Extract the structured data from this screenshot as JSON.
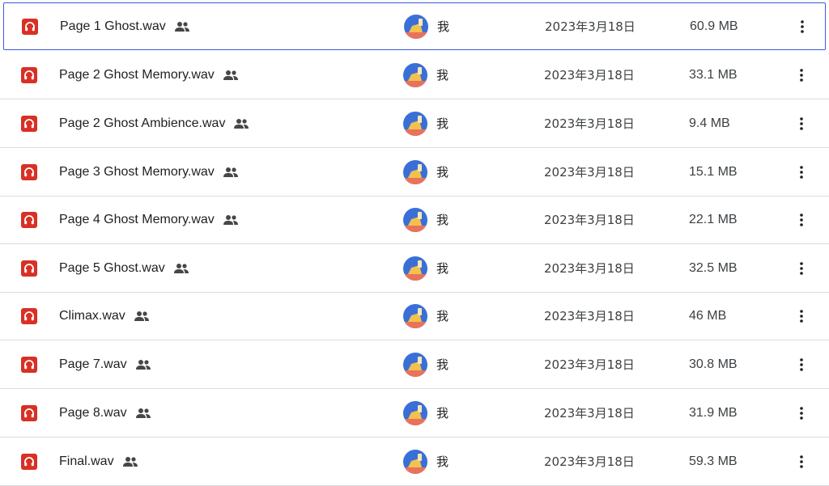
{
  "colors": {
    "audio_icon": "#d93025",
    "selection_border": "#3b5bdb",
    "divider": "#dadce0",
    "avatar_bg": "#3a6fd8"
  },
  "icons": {
    "file_type": "headphones-icon",
    "shared": "people-icon",
    "more": "more-vertical-icon"
  },
  "files": [
    {
      "name": "Page 1 Ghost.wav",
      "owner": "我",
      "modified": "2023年3月18日",
      "size": "60.9 MB",
      "selected": true
    },
    {
      "name": "Page 2 Ghost Memory.wav",
      "owner": "我",
      "modified": "2023年3月18日",
      "size": "33.1 MB",
      "selected": false
    },
    {
      "name": "Page 2 Ghost Ambience.wav",
      "owner": "我",
      "modified": "2023年3月18日",
      "size": "9.4 MB",
      "selected": false
    },
    {
      "name": "Page 3 Ghost Memory.wav",
      "owner": "我",
      "modified": "2023年3月18日",
      "size": "15.1 MB",
      "selected": false
    },
    {
      "name": "Page 4 Ghost Memory.wav",
      "owner": "我",
      "modified": "2023年3月18日",
      "size": "22.1 MB",
      "selected": false
    },
    {
      "name": "Page 5 Ghost.wav",
      "owner": "我",
      "modified": "2023年3月18日",
      "size": "32.5 MB",
      "selected": false
    },
    {
      "name": "Climax.wav",
      "owner": "我",
      "modified": "2023年3月18日",
      "size": "46 MB",
      "selected": false
    },
    {
      "name": "Page 7.wav",
      "owner": "我",
      "modified": "2023年3月18日",
      "size": "30.8 MB",
      "selected": false
    },
    {
      "name": "Page 8.wav",
      "owner": "我",
      "modified": "2023年3月18日",
      "size": "31.9 MB",
      "selected": false
    },
    {
      "name": "Final.wav",
      "owner": "我",
      "modified": "2023年3月18日",
      "size": "59.3 MB",
      "selected": false
    }
  ]
}
